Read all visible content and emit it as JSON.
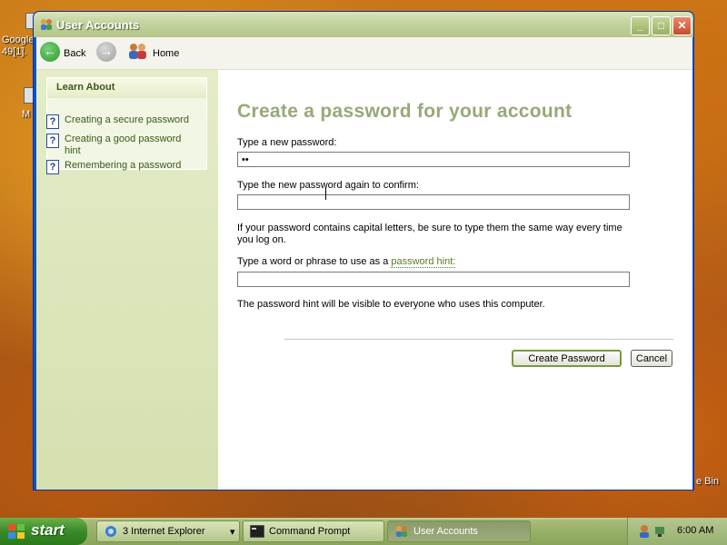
{
  "desktop": {
    "icon_labels": [
      "Google",
      "49[1].",
      "M",
      "e Bin"
    ]
  },
  "window": {
    "title": "User Accounts",
    "controls": {
      "minimize": "_",
      "maximize": "□",
      "close": "✕"
    }
  },
  "nav": {
    "back_label": "Back",
    "home_label": "Home"
  },
  "learn_about": {
    "heading": "Learn About",
    "items": [
      {
        "label": "Creating a secure password"
      },
      {
        "label": "Creating a good password hint"
      },
      {
        "label": "Remembering a password"
      }
    ]
  },
  "form": {
    "title": "Create a password for your account",
    "new_password_label": "Type a new password:",
    "new_password_value": "••",
    "confirm_label": "Type the new password again to confirm:",
    "confirm_value": "",
    "caps_note": "If your password contains capital letters, be sure to type them the same way every time you log on.",
    "hint_label_prefix": "Type a word or phrase to use as a ",
    "hint_label_link": "password hint:",
    "hint_value": "",
    "hint_note": "The password hint will be visible to everyone who uses this computer.",
    "create_button": "Create Password",
    "cancel_button": "Cancel"
  },
  "taskbar": {
    "start_label": "start",
    "items": [
      {
        "label": "3 Internet Explorer",
        "dropdown": "▾"
      },
      {
        "label": "Command Prompt"
      },
      {
        "label": "User Accounts"
      }
    ],
    "clock": "6:00 AM"
  },
  "colors": {
    "title_green": "#98a878",
    "link_green": "#3a5a1a",
    "window_blue": "#0a53c8"
  }
}
